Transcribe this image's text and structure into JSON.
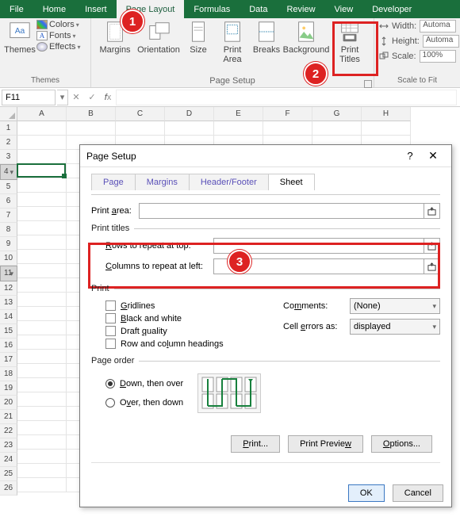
{
  "tabs": {
    "file": "File",
    "home": "Home",
    "insert": "Insert",
    "page_layout": "Page Layout",
    "formulas": "Formulas",
    "data": "Data",
    "review": "Review",
    "view": "View",
    "developer": "Developer"
  },
  "ribbon": {
    "themes": {
      "label": "Themes",
      "btn": "Themes",
      "colors": "Colors",
      "fonts": "Fonts",
      "effects": "Effects"
    },
    "page_setup": {
      "label": "Page Setup",
      "margins": "Margins",
      "orientation": "Orientation",
      "size": "Size",
      "print_area": "Print\nArea",
      "breaks": "Breaks",
      "background": "Background",
      "print_titles": "Print\nTitles"
    },
    "scale": {
      "label": "Scale to Fit",
      "width_lbl": "Width:",
      "width_val": "Automa",
      "height_lbl": "Height:",
      "height_val": "Automa",
      "scale_lbl": "Scale:",
      "scale_val": "100%"
    }
  },
  "namebox": {
    "ref": "F11"
  },
  "columns": [
    "A",
    "B",
    "C",
    "D",
    "E",
    "F",
    "G",
    "H"
  ],
  "rows": [
    "1",
    "2",
    "3",
    "4",
    "5",
    "6",
    "7",
    "8",
    "9",
    "10",
    "11",
    "12",
    "13",
    "14",
    "15",
    "16",
    "17",
    "18",
    "19",
    "20",
    "21",
    "22",
    "23",
    "24",
    "25",
    "26"
  ],
  "dialog": {
    "title": "Page Setup",
    "tabs": {
      "page": "Page",
      "margins": "Margins",
      "header_footer": "Header/Footer",
      "sheet": "Sheet"
    },
    "print_area_lbl": "Print area:",
    "print_area_val": "",
    "print_titles_lbl": "Print titles",
    "rows_repeat_lbl": "Rows to repeat at top:",
    "rows_repeat_val": "",
    "cols_repeat_lbl": "Columns to repeat at left:",
    "cols_repeat_val": "",
    "print_lbl": "Print",
    "gridlines": "Gridlines",
    "bw": "Black and white",
    "draft": "Draft quality",
    "rowcol": "Row and column headings",
    "comments_lbl": "Comments:",
    "comments_val": "(None)",
    "cellerr_lbl": "Cell errors as:",
    "cellerr_val": "displayed",
    "page_order_lbl": "Page order",
    "down_over": "Down, then over",
    "over_down": "Over, then down",
    "print_btn": "Print...",
    "preview_btn": "Print Preview",
    "options_btn": "Options...",
    "ok": "OK",
    "cancel": "Cancel"
  },
  "steps": {
    "s1": "1",
    "s2": "2",
    "s3": "3"
  }
}
